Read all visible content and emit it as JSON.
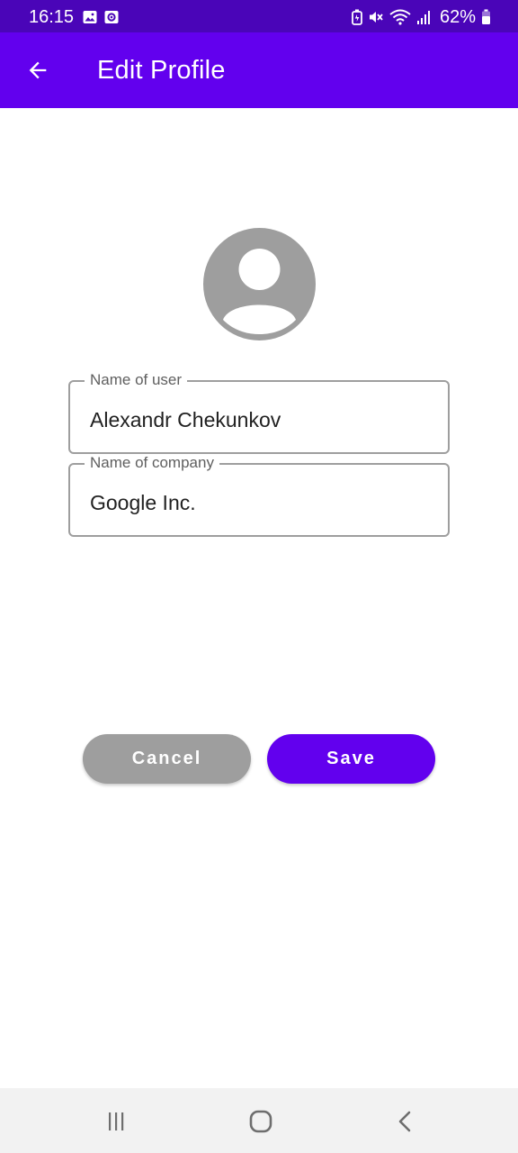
{
  "status_bar": {
    "time": "16:15",
    "battery": "62%",
    "background": "#4a05b8",
    "icons_left": [
      "image-icon",
      "notification-icon"
    ],
    "icons_right": [
      "battery-saver-icon",
      "mute-icon",
      "wifi-icon",
      "signal-icon",
      "battery-icon"
    ]
  },
  "app_bar": {
    "title": "Edit Profile",
    "background": "#6200ee",
    "back_icon": "arrow-back-icon"
  },
  "avatar": {
    "icon": "person-avatar-icon",
    "color": "#9e9e9e"
  },
  "form": {
    "user_name": {
      "label": "Name of user",
      "value": "Alexandr Chekunkov"
    },
    "company_name": {
      "label": "Name of company",
      "value": "Google Inc."
    }
  },
  "actions": {
    "cancel_label": "Cancel",
    "save_label": "Save",
    "cancel_color": "#9e9e9e",
    "save_color": "#6200ee"
  },
  "nav_bar": {
    "items": [
      "recents-icon",
      "home-icon",
      "back-icon"
    ]
  }
}
